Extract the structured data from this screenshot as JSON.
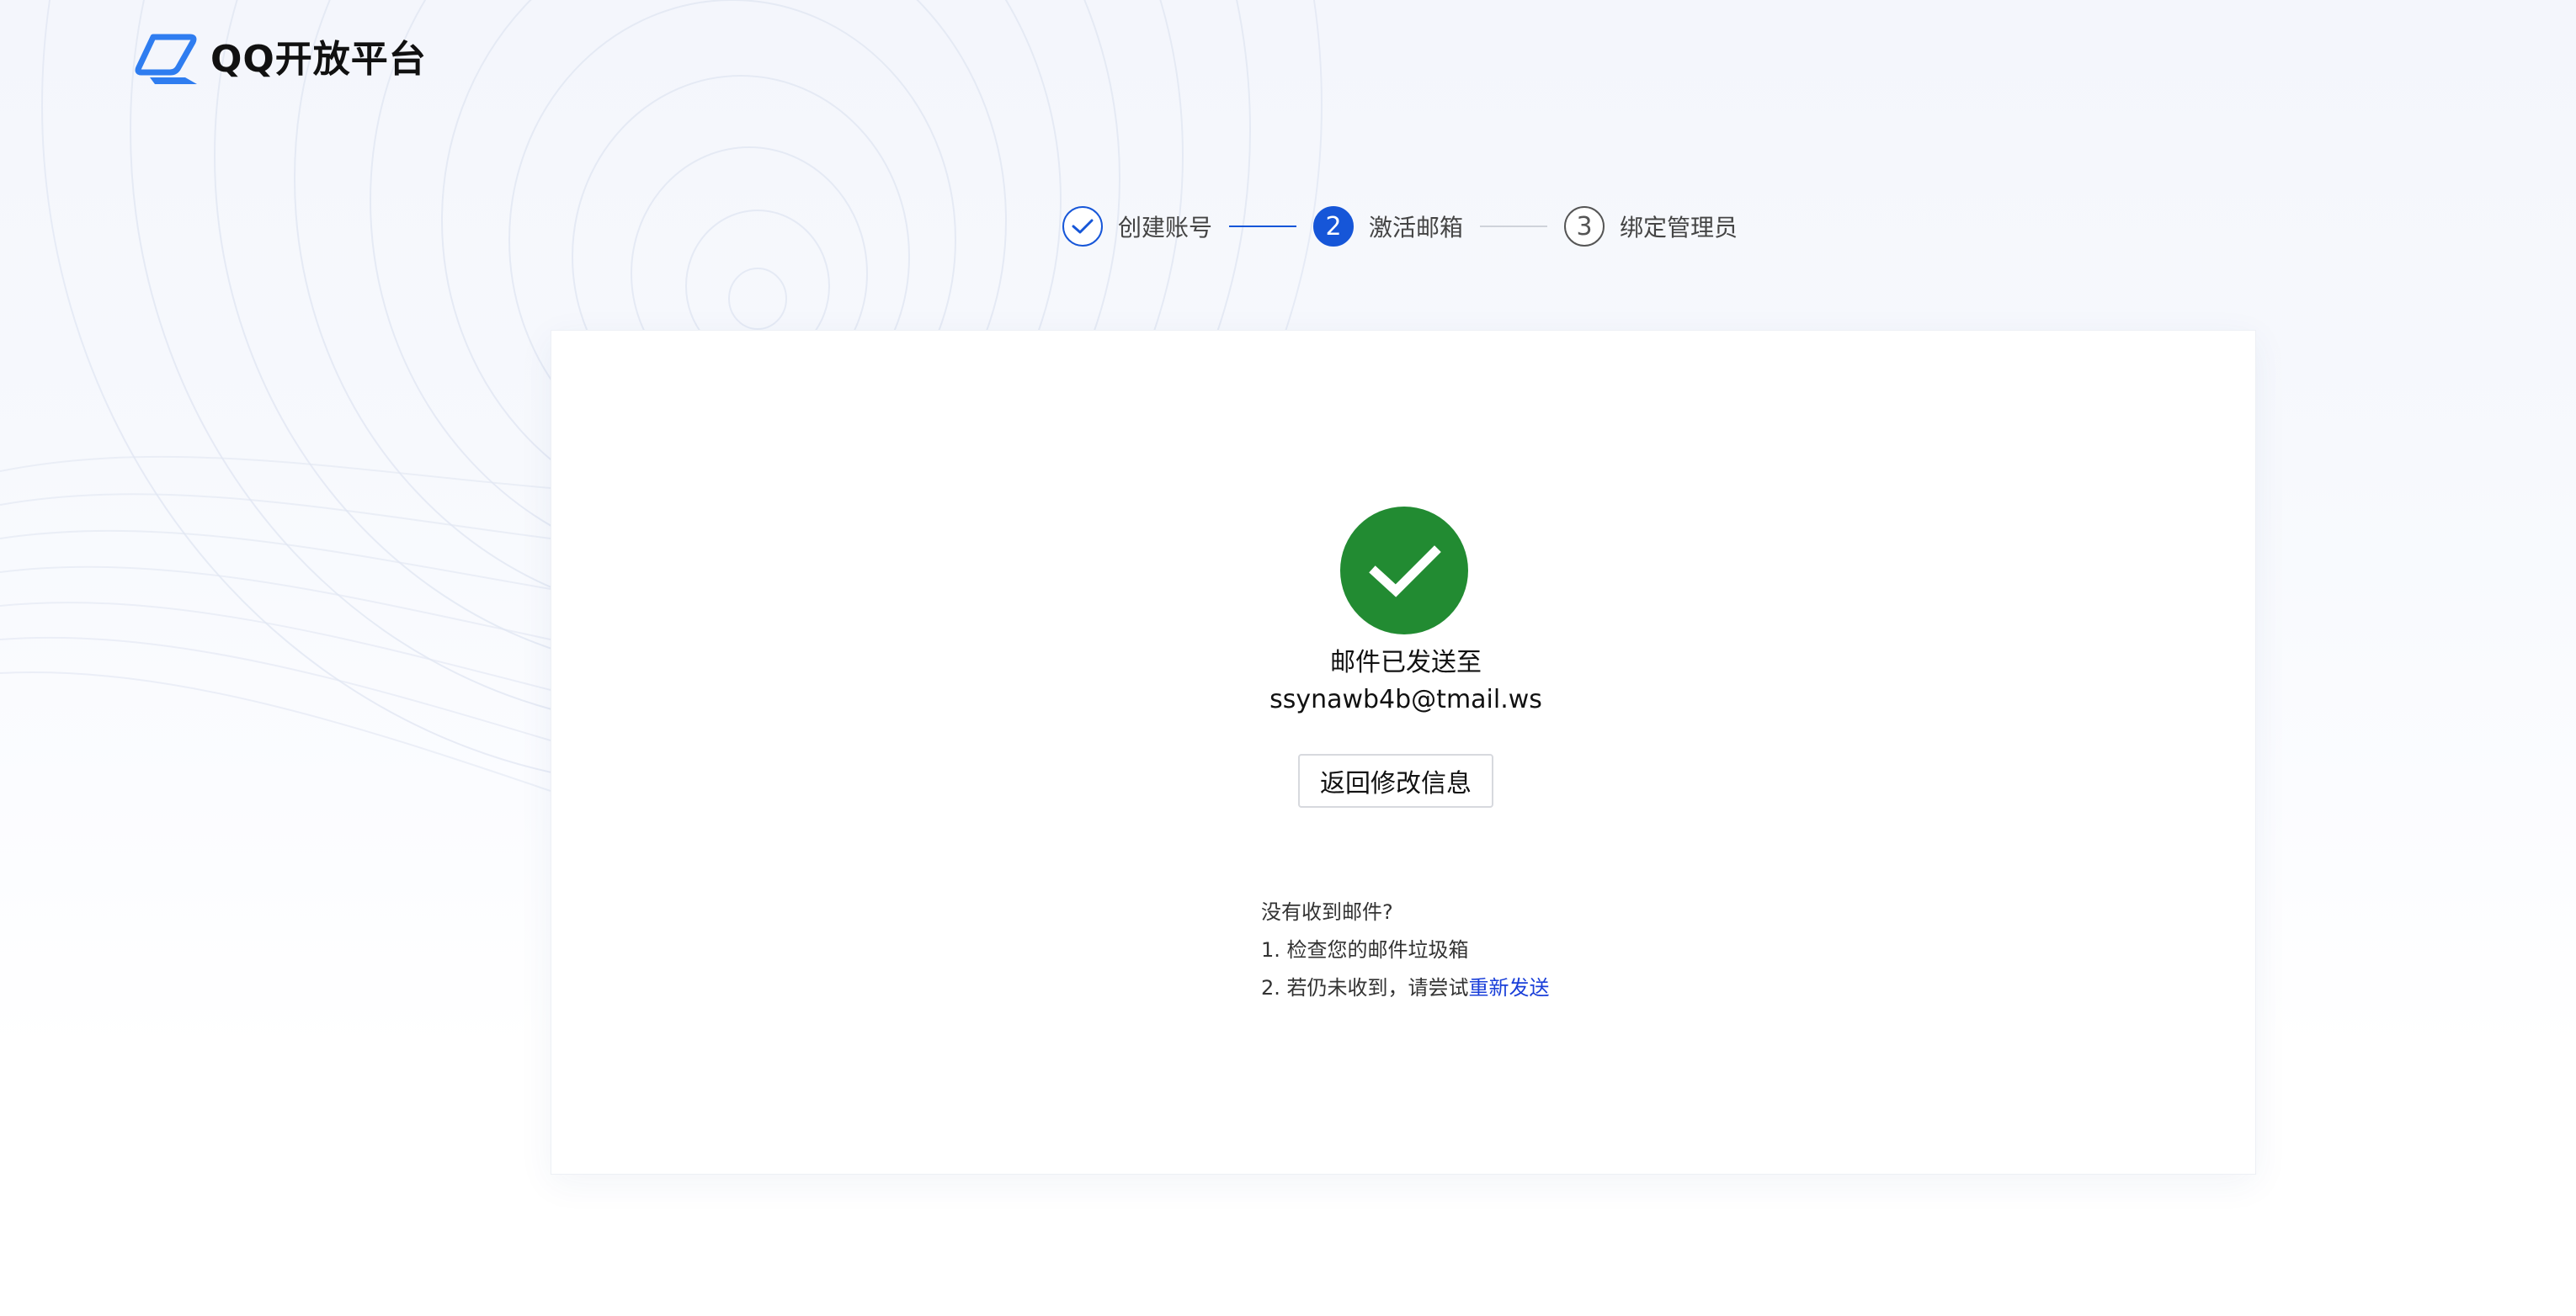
{
  "brand": {
    "name": "QQ开放平台",
    "colors": {
      "primary": "#1656d8",
      "logo_blue": "#2f7df0",
      "success": "#228b32",
      "link": "#1a3fd9"
    }
  },
  "steps": [
    {
      "number": "1",
      "label": "创建账号",
      "state": "done",
      "icon": "check-icon"
    },
    {
      "number": "2",
      "label": "激活邮箱",
      "state": "active"
    },
    {
      "number": "3",
      "label": "绑定管理员",
      "state": "todo"
    }
  ],
  "result": {
    "icon": "success-check-icon",
    "title": "邮件已发送至",
    "email": "ssynawb4b@tmail.ws",
    "back_button_label": "返回修改信息"
  },
  "help": {
    "heading": "没有收到邮件?",
    "tip1": "1. 检查您的邮件垃圾箱",
    "tip2_prefix": "2. 若仍未收到，请尝试",
    "resend_label": "重新发送"
  }
}
